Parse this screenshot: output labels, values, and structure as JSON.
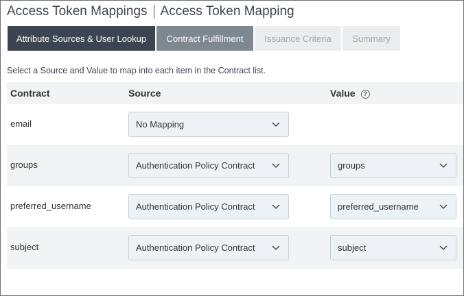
{
  "header": {
    "section": "Access Token Mappings",
    "page": "Access Token Mapping"
  },
  "tabs": [
    {
      "label": "Attribute Sources & User Lookup",
      "state": "active"
    },
    {
      "label": "Contract Fulfillment",
      "state": "done"
    },
    {
      "label": "Issuance Criteria",
      "state": "pending"
    },
    {
      "label": "Summary",
      "state": "pending"
    }
  ],
  "instructions": "Select a Source and Value to map into each item in the Contract list.",
  "table": {
    "columns": {
      "contract": "Contract",
      "source": "Source",
      "value": "Value"
    },
    "help_icon": "?",
    "rows": [
      {
        "contract": "email",
        "source": "No Mapping",
        "value": ""
      },
      {
        "contract": "groups",
        "source": "Authentication Policy Contract",
        "value": "groups"
      },
      {
        "contract": "preferred_username",
        "source": "Authentication Policy Contract",
        "value": "preferred_username"
      },
      {
        "contract": "subject",
        "source": "Authentication Policy Contract",
        "value": "subject"
      }
    ]
  },
  "colors": {
    "active_tab": "#3d4451",
    "done_tab": "#7d8891",
    "pending_tab": "#ebedef",
    "row_shade": "#f2f3f5",
    "select_bg": "#edf2f7"
  }
}
